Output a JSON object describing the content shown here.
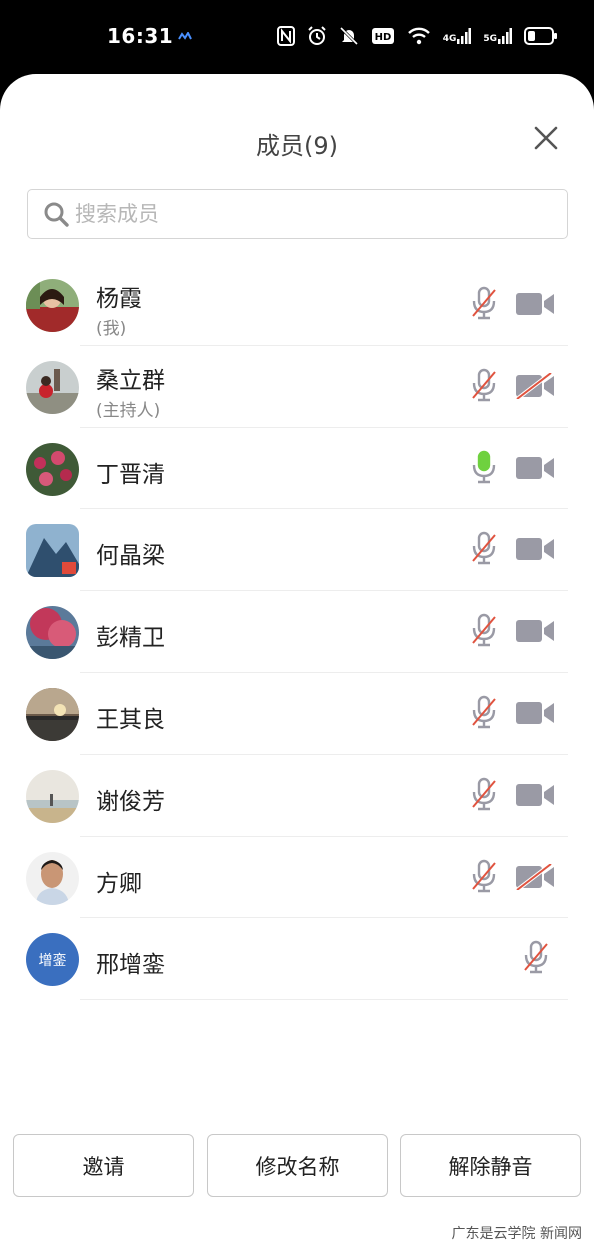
{
  "status_bar": {
    "time": "16:31",
    "net_4g": "4G",
    "net_5g": "5G"
  },
  "dialog": {
    "title": "成员(9)"
  },
  "search": {
    "placeholder": "搜索成员"
  },
  "members": [
    {
      "name": "杨霞",
      "role": "(我)",
      "mic": "muted",
      "camera": "off"
    },
    {
      "name": "桑立群",
      "role": "(主持人)",
      "mic": "muted",
      "camera": "disabled"
    },
    {
      "name": "丁晋清",
      "role": "",
      "mic": "speaking",
      "camera": "off"
    },
    {
      "name": "何晶梁",
      "role": "",
      "mic": "muted",
      "camera": "off"
    },
    {
      "name": "彭精卫",
      "role": "",
      "mic": "muted",
      "camera": "off"
    },
    {
      "name": "王其良",
      "role": "",
      "mic": "muted",
      "camera": "off"
    },
    {
      "name": "谢俊芳",
      "role": "",
      "mic": "muted",
      "camera": "off"
    },
    {
      "name": "方卿",
      "role": "",
      "mic": "muted",
      "camera": "disabled"
    },
    {
      "name": "邢增銮",
      "role": "",
      "avatar_text": "增銮",
      "mic": "muted",
      "camera": "none"
    }
  ],
  "buttons": {
    "invite": "邀请",
    "rename": "修改名称",
    "unmute": "解除静音"
  },
  "watermark": "广东是云学院 新闻网",
  "colors": {
    "accent_mic_active": "#6fd13f",
    "muted_slash": "#e0533f",
    "icon_gray": "#9a9aa5",
    "avatar_text_bg": "#3a6fbf"
  }
}
